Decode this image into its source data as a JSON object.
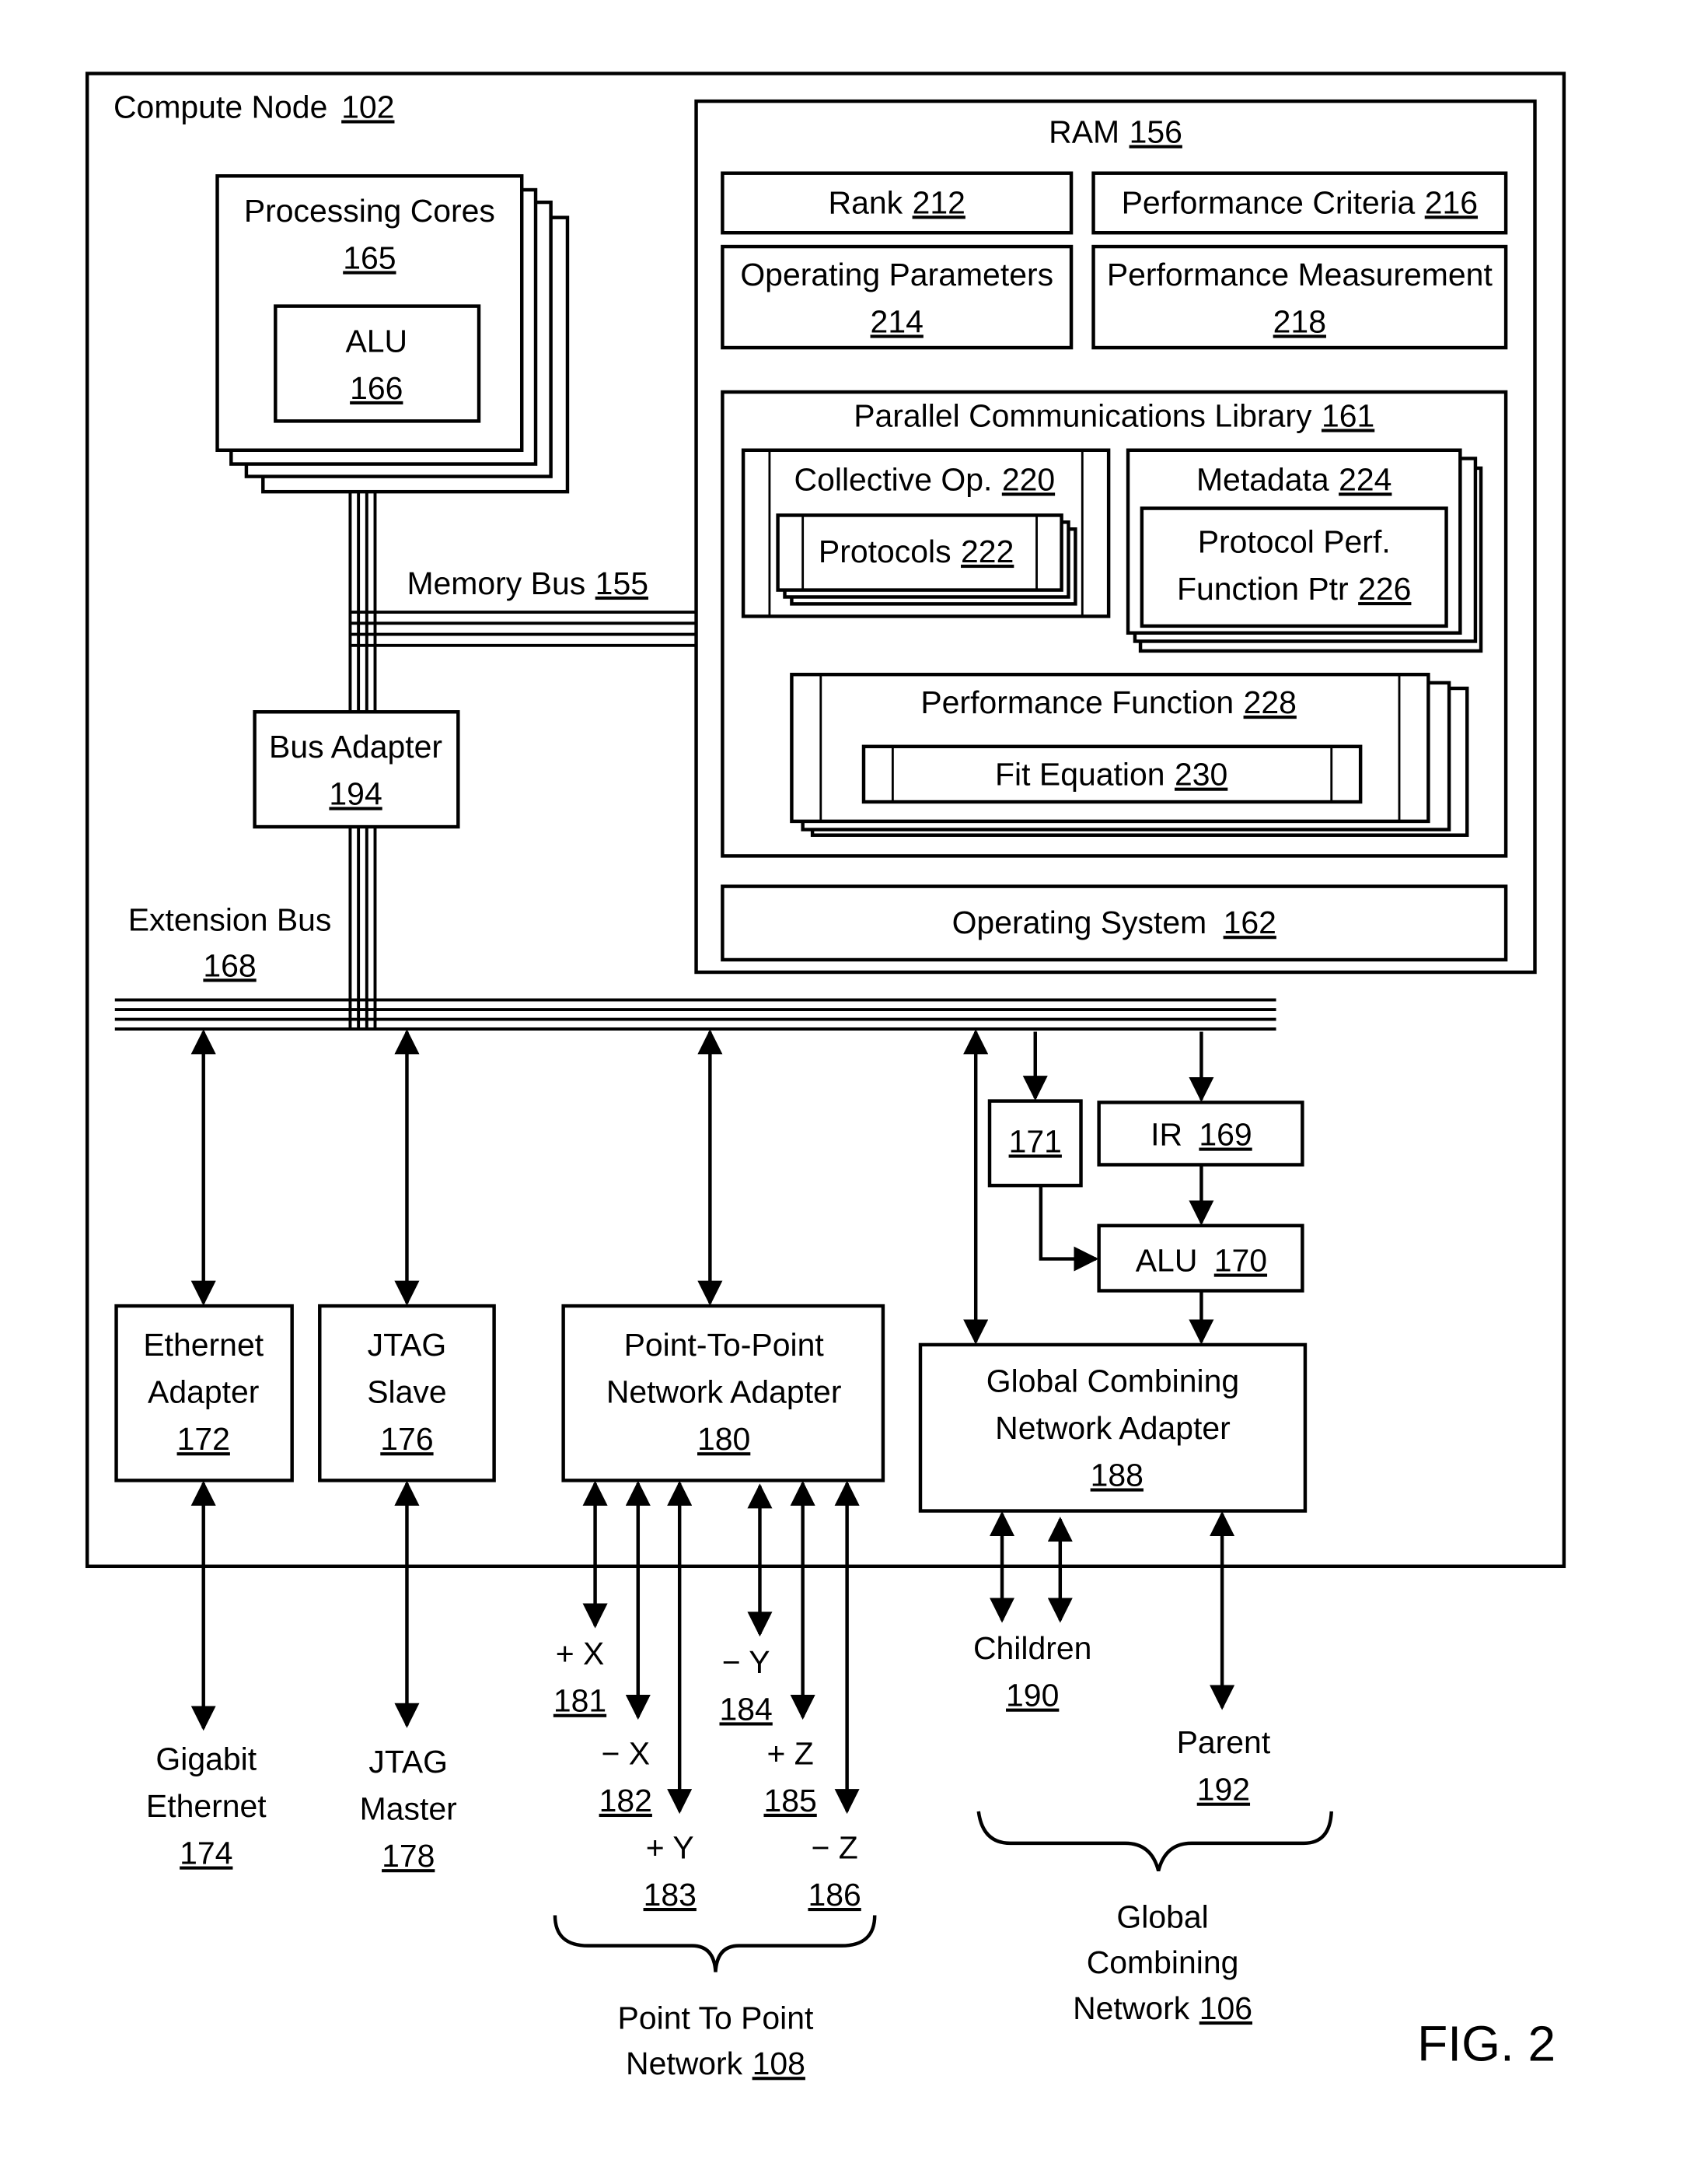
{
  "figure_label": "FIG. 2",
  "compute_node": {
    "label": "Compute Node",
    "ref": "102"
  },
  "processing_cores": {
    "label": "Processing Cores",
    "ref": "165"
  },
  "core_alu": {
    "label": "ALU",
    "ref": "166"
  },
  "memory_bus": {
    "label": "Memory Bus",
    "ref": "155"
  },
  "bus_adapter": {
    "label": "Bus Adapter",
    "ref": "194"
  },
  "extension_bus": {
    "label": "Extension Bus",
    "ref": "168"
  },
  "ram": {
    "label": "RAM",
    "ref": "156",
    "rank": {
      "label": "Rank",
      "ref": "212"
    },
    "performance_criteria": {
      "label": "Performance Criteria",
      "ref": "216"
    },
    "operating_parameters": {
      "label": "Operating Parameters",
      "ref": "214"
    },
    "performance_measurement": {
      "label": "Performance Measurement",
      "ref": "218"
    },
    "pcl": {
      "label": "Parallel Communications Library",
      "ref": "161",
      "collective_op": {
        "label": "Collective Op.",
        "ref": "220"
      },
      "protocols": {
        "label": "Protocols",
        "ref": "222"
      },
      "metadata": {
        "label": "Metadata",
        "ref": "224"
      },
      "protocol_perf_ptr": {
        "line1": "Protocol Perf.",
        "line2": "Function Ptr",
        "ref": "226"
      },
      "performance_function": {
        "label": "Performance Function",
        "ref": "228"
      },
      "fit_equation": {
        "label": "Fit Equation",
        "ref": "230"
      }
    },
    "operating_system": {
      "label": "Operating System",
      "ref": "162"
    }
  },
  "adapters": {
    "ethernet": {
      "line1": "Ethernet",
      "line2": "Adapter",
      "ref": "172"
    },
    "jtag_slave": {
      "line1": "JTAG",
      "line2": "Slave",
      "ref": "176"
    },
    "p2p": {
      "line1": "Point-To-Point",
      "line2": "Network Adapter",
      "ref": "180"
    },
    "gcn": {
      "line1": "Global Combining",
      "line2": "Network Adapter",
      "ref": "188"
    },
    "box171": {
      "ref": "171"
    },
    "ir": {
      "label": "IR",
      "ref": "169"
    },
    "alu": {
      "label": "ALU",
      "ref": "170"
    }
  },
  "external": {
    "gigabit_ethernet": {
      "line1": "Gigabit",
      "line2": "Ethernet",
      "ref": "174"
    },
    "jtag_master": {
      "line1": "JTAG",
      "line2": "Master",
      "ref": "178"
    },
    "links": [
      {
        "label": "+ X",
        "ref": "181"
      },
      {
        "label": "− X",
        "ref": "182"
      },
      {
        "label": "+ Y",
        "ref": "183"
      },
      {
        "label": "− Y",
        "ref": "184"
      },
      {
        "label": "+ Z",
        "ref": "185"
      },
      {
        "label": "− Z",
        "ref": "186"
      }
    ],
    "p2p_network": {
      "line1": "Point To Point",
      "line2": "Network",
      "ref": "108"
    },
    "children": {
      "label": "Children",
      "ref": "190"
    },
    "parent": {
      "label": "Parent",
      "ref": "192"
    },
    "gcn_network": {
      "line1": "Global",
      "line2": "Combining",
      "line3": "Network",
      "ref": "106"
    }
  }
}
